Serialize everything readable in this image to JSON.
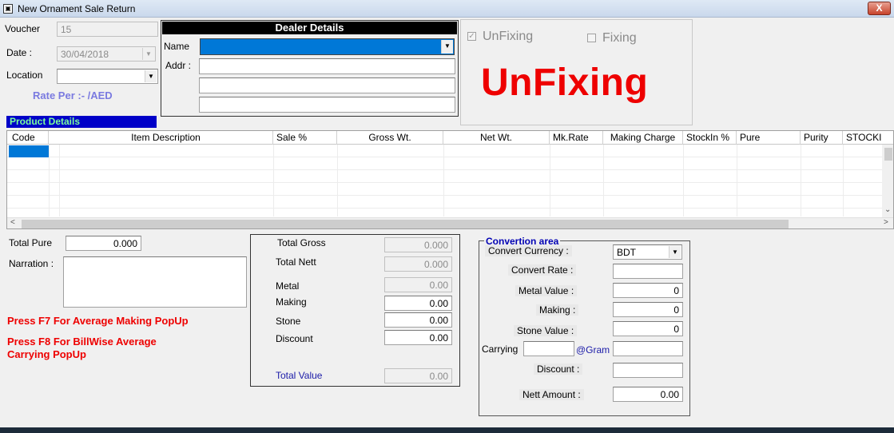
{
  "window": {
    "title": "New Ornament Sale Return",
    "close_label": "X"
  },
  "header": {
    "voucher_label": "Voucher",
    "voucher_value": "15",
    "date_label": "Date :",
    "date_value": "30/04/2018",
    "location_label": "Location",
    "location_value": "",
    "rate_per": "Rate Per :-  /AED"
  },
  "dealer": {
    "heading": "Dealer Details",
    "name_label": "Name",
    "name_value": "",
    "addr_label": "Addr :",
    "addr_lines": [
      "",
      "",
      ""
    ]
  },
  "fixing": {
    "unfixing_label": "UnFixing",
    "unfixing_checked": true,
    "fixing_label": "Fixing",
    "fixing_checked": false,
    "status_text": "UnFixing",
    "status_color": "#ee0000"
  },
  "product": {
    "heading": "Product Details",
    "columns": [
      "Code",
      "Item Description",
      "Sale %",
      "Gross Wt.",
      "Net Wt.",
      "Mk.Rate",
      "Making Charge",
      "StockIn %",
      "Pure",
      "Purity",
      "STOCKI"
    ]
  },
  "left_panel": {
    "total_pure_label": "Total  Pure",
    "total_pure_value": "0.000",
    "narration_label": "Narration :",
    "narration_value": "",
    "note_f7": "Press F7 For Average Making PopUp",
    "note_f8_line1": "Press F8 For BillWise Average",
    "note_f8_line2": "Carrying PopUp"
  },
  "totals": {
    "total_gross_label": "Total Gross",
    "total_gross_value": "0.000",
    "total_nett_label": "Total Nett",
    "total_nett_value": "0.000",
    "metal_label": "Metal",
    "metal_value": "0.00",
    "making_label": "Making",
    "making_value": "0.00",
    "stone_label": "Stone",
    "stone_value": "0.00",
    "discount_label": "Discount",
    "discount_value": "0.00",
    "total_value_label": "Total Value",
    "total_value_value": "0.00"
  },
  "conversion": {
    "title": "Convertion area",
    "currency_label": "Convert Currency :",
    "currency_value": "BDT",
    "rate_label": "Convert Rate :",
    "rate_value": "",
    "metal_value_label": "Metal Value :",
    "metal_value": "0",
    "making_label": "Making :",
    "making_value": "0",
    "stone_value_label": "Stone Value :",
    "stone_value": "0",
    "carrying_label": "Carrying",
    "carrying_value": "",
    "gram_label": "@Gram",
    "gram_value": "",
    "discount_label": "Discount :",
    "discount_value": "",
    "nett_amount_label": "Nett Amount :",
    "nett_amount_value": "0.00"
  }
}
